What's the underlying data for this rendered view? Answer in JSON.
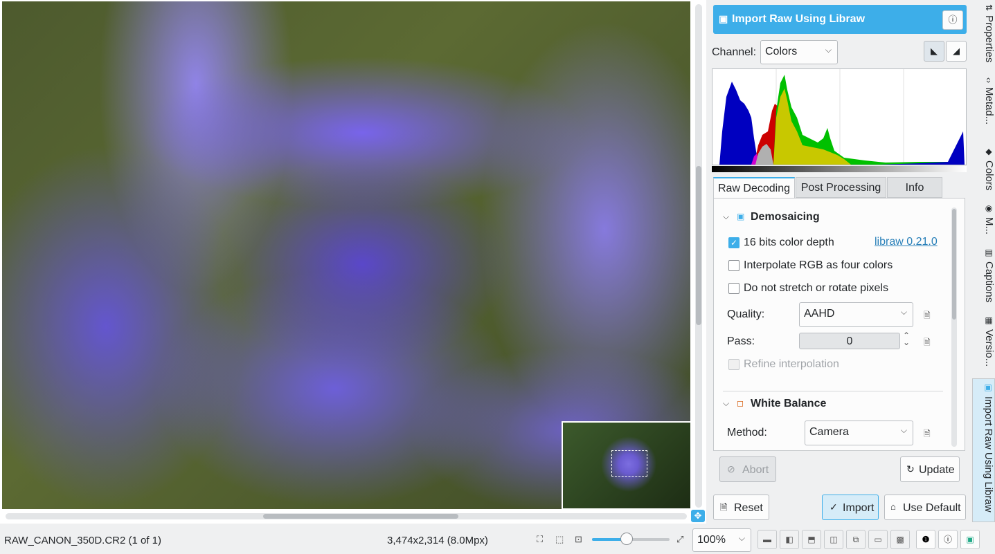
{
  "panel": {
    "title": "Import Raw Using Libraw",
    "channel_label": "Channel:",
    "channel_value": "Colors",
    "tabs": [
      "Raw Decoding",
      "Post Processing",
      "Info"
    ],
    "active_tab": "Raw Decoding",
    "demosaicing": {
      "title": "Demosaicing",
      "bits_label": "16 bits color depth",
      "bits_checked": true,
      "libraw_link": "libraw 0.21.0",
      "interpolate_label": "Interpolate RGB as four colors",
      "interpolate_checked": false,
      "stretch_label": "Do not stretch or rotate pixels",
      "stretch_checked": false,
      "quality_label": "Quality:",
      "quality_value": "AAHD",
      "pass_label": "Pass:",
      "pass_value": "0",
      "refine_label": "Refine interpolation",
      "refine_checked": false
    },
    "white_balance": {
      "title": "White Balance",
      "method_label": "Method:",
      "method_value": "Camera"
    },
    "abort_label": "Abort",
    "update_label": "Update",
    "reset_label": "Reset",
    "import_label": "Import",
    "use_default_label": "Use Default"
  },
  "sidebar": {
    "tabs": [
      "Properties",
      "Metad...",
      "Colors",
      "M...",
      "Captions",
      "Versio...",
      "Import Raw Using Libraw"
    ]
  },
  "status": {
    "filename": "RAW_CANON_350D.CR2 (1 of 1)",
    "dimensions": "3,474x2,314 (8.0Mpx)",
    "zoom": "100%",
    "zoom_slider_fraction": 0.45
  },
  "colors": {
    "accent": "#3daee9",
    "hist_blue": "#0000c0",
    "hist_red": "#cc0000",
    "hist_green": "#00c000",
    "hist_yellow": "#c8c800",
    "hist_magenta": "#d000d0",
    "hist_gray": "#b0b0b0"
  }
}
